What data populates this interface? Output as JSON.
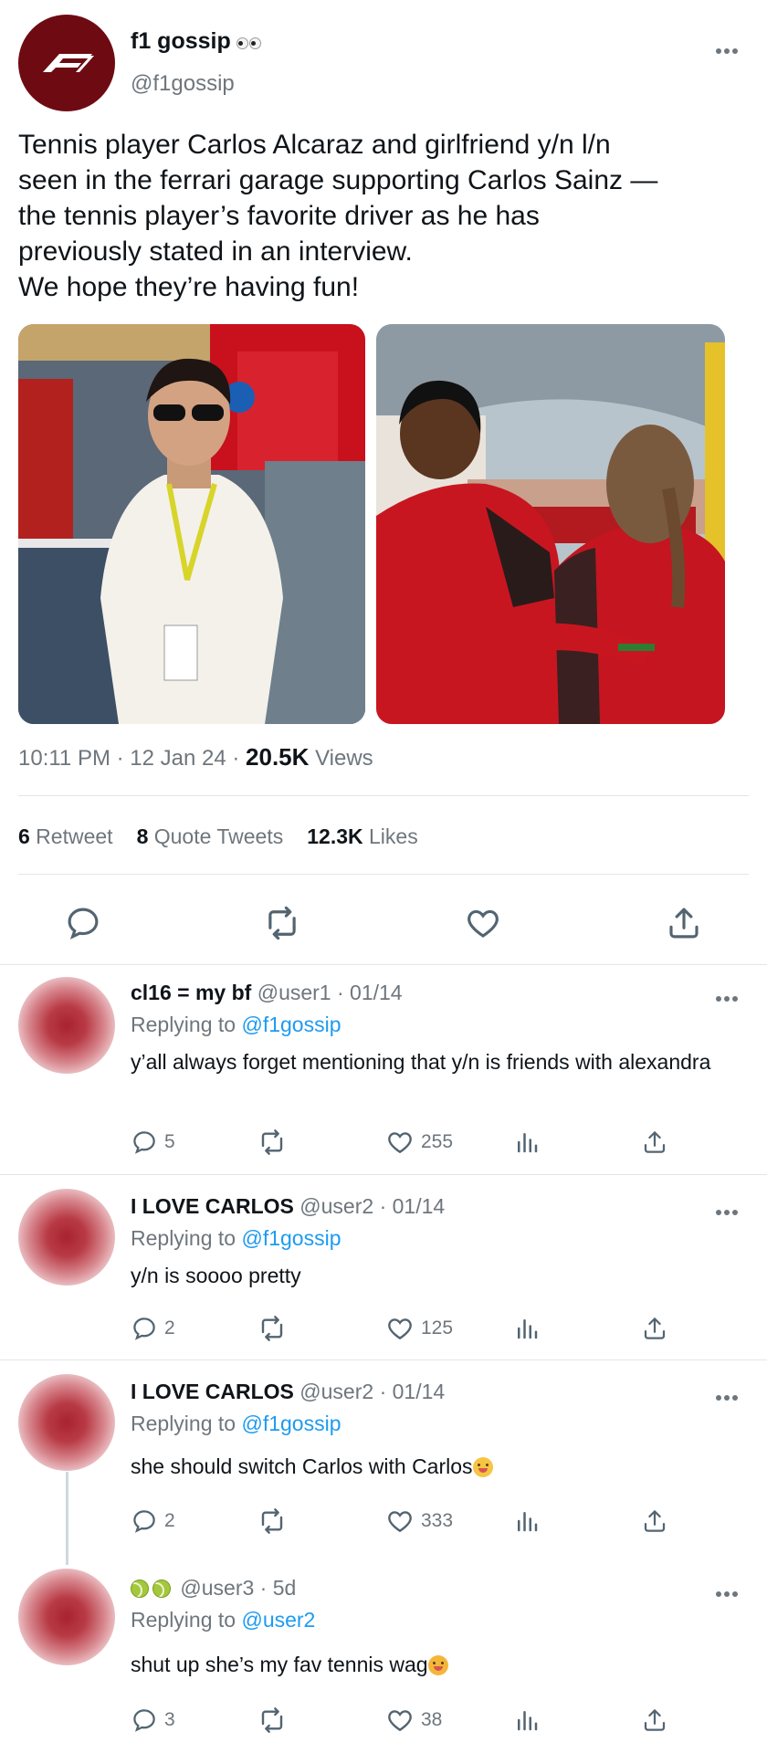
{
  "colors": {
    "link": "#1d9bf0",
    "muted": "#6e767d",
    "text": "#0f1419",
    "brand": "#6e0b12"
  },
  "tweet": {
    "author_name": "f1 gossip",
    "author_handle": "@f1gossip",
    "text": "Tennis player Carlos Alcaraz and girlfriend y/n l/n\nseen in the ferrari garage supporting Carlos Sainz —\nthe tennis player’s favorite driver as he has\npreviously stated in an interview.\nWe hope they’re having fun!",
    "time": "10:11 PM · 12 Jan 24 · ",
    "views_count": "20.5K",
    "views_label": " Views",
    "retweets_count": "6",
    "retweets_label": " Retweet",
    "quotes_count": "8",
    "quotes_label": " Quote Tweets",
    "likes_count": "12.3K",
    "likes_label": " Likes",
    "images": [
      "carlos-alcaraz-white-shirt-photo",
      "ferrari-couple-back-view-photo"
    ]
  },
  "replies": [
    {
      "name": "cl16 = my bf",
      "handle_time": " @user1 · 01/14",
      "replying_prefix": "Replying to ",
      "replying_to": "@f1gossip",
      "text": "y’all always forget mentioning that y/n is friends with alexandra",
      "reply_count": "5",
      "like_count": "255"
    },
    {
      "name": "I LOVE CARLOS",
      "handle_time": " @user2 · 01/14",
      "replying_prefix": "Replying to ",
      "replying_to": "@f1gossip",
      "text": "y/n is soooo pretty",
      "reply_count": "2",
      "like_count": "125"
    },
    {
      "name": "I LOVE CARLOS",
      "handle_time": " @user2 · 01/14",
      "replying_prefix": "Replying to ",
      "replying_to": "@f1gossip",
      "text": "she should switch Carlos with Carlos",
      "emoji": "smiling-face-emoji",
      "reply_count": "2",
      "like_count": "333"
    },
    {
      "name_icons": [
        "tennis-ball-icon",
        "tennis-ball-icon"
      ],
      "handle_time": " @user3 · 5d",
      "replying_prefix": "Replying to ",
      "replying_to": "@user2",
      "text": "shut up she’s my fav tennis wag",
      "emoji": "weary-face-emoji",
      "reply_count": "3",
      "like_count": "38"
    }
  ]
}
